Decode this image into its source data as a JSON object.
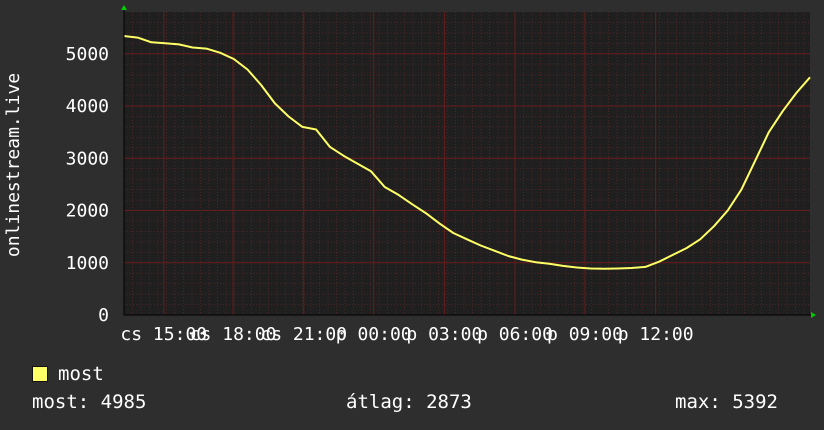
{
  "chart_data": {
    "type": "line",
    "ylabel": "onlinestream.live",
    "yticks": [
      0,
      1000,
      2000,
      3000,
      4000,
      5000
    ],
    "ylim": [
      0,
      5800
    ],
    "xlim": [
      0,
      100
    ],
    "xticks": [
      {
        "pos": 5.8,
        "label": "cs 15:00"
      },
      {
        "pos": 15.9,
        "label": "cs 18:00"
      },
      {
        "pos": 26.2,
        "label": "cs 21:00"
      },
      {
        "pos": 36.4,
        "label": "p 00:00"
      },
      {
        "pos": 46.7,
        "label": "p 03:00"
      },
      {
        "pos": 57.0,
        "label": "p 06:00"
      },
      {
        "pos": 67.2,
        "label": "p 09:00"
      },
      {
        "pos": 77.5,
        "label": "p 12:00"
      }
    ],
    "grid": true,
    "colors": {
      "line": "#ffff66",
      "grid": "#ff2222",
      "axis": "#00cc00"
    },
    "series": [
      {
        "name": "most",
        "x": [
          0,
          2,
          4,
          6,
          8,
          10,
          12,
          14,
          16,
          18,
          20,
          22,
          24,
          26,
          28,
          30,
          32,
          34,
          36,
          38,
          40,
          42,
          44,
          46,
          48,
          50,
          52,
          54,
          56,
          58,
          60,
          62,
          64,
          66,
          68,
          70,
          72,
          74,
          76,
          78,
          80,
          82,
          84,
          86,
          88,
          90,
          92,
          94,
          96,
          98,
          100
        ],
        "values": [
          5340,
          5310,
          5220,
          5200,
          5180,
          5120,
          5100,
          5020,
          4900,
          4700,
          4400,
          4050,
          3800,
          3600,
          3550,
          3220,
          3050,
          2900,
          2750,
          2450,
          2300,
          2120,
          1950,
          1750,
          1570,
          1450,
          1330,
          1230,
          1130,
          1060,
          1010,
          980,
          940,
          910,
          890,
          885,
          890,
          900,
          920,
          1020,
          1150,
          1280,
          1450,
          1700,
          2000,
          2400,
          2950,
          3500,
          3900,
          4250,
          4550
        ]
      }
    ]
  },
  "legend": {
    "label": "most",
    "color": "#ffff66"
  },
  "stats": {
    "most": "most: 4985",
    "avg": "átlag: 2873",
    "max": "max: 5392"
  }
}
